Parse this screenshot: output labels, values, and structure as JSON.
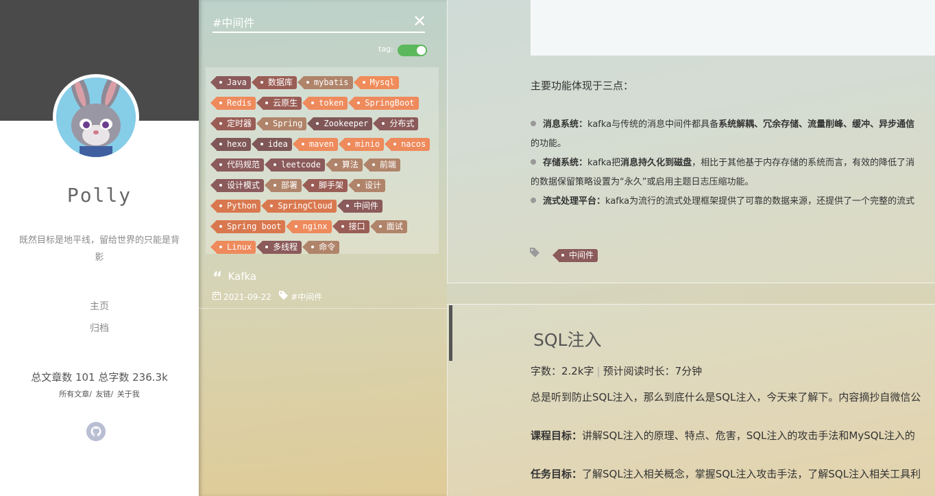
{
  "sidebar": {
    "author_name": "Polly",
    "motto": "既然目标是地平线，留给世界的只能是背影",
    "nav": [
      "主页",
      "归档"
    ],
    "stats": "总文章数 101 总字数 236.3k",
    "sub_links": [
      "所有文章/",
      "友链/",
      "关于我"
    ],
    "icons": {
      "github": "github-icon"
    }
  },
  "search": {
    "value": "#中间件",
    "toggle_label": "tag:",
    "toggle_on": true,
    "tags": [
      {
        "label": "Java",
        "color": "#8b5a5a",
        "mono": true
      },
      {
        "label": "数据库",
        "color": "#9a5d55",
        "mono": false
      },
      {
        "label": "mybatis",
        "color": "#b0846a",
        "mono": true
      },
      {
        "label": "Mysql",
        "color": "#f08c5a",
        "mono": true
      },
      {
        "label": "Redis",
        "color": "#ee8a5c",
        "mono": true
      },
      {
        "label": "云原生",
        "color": "#9a5d55",
        "mono": false
      },
      {
        "label": "token",
        "color": "#ee8a5c",
        "mono": true
      },
      {
        "label": "SpringBoot",
        "color": "#ee8a5c",
        "mono": true
      },
      {
        "label": "定时器",
        "color": "#9a5d55",
        "mono": false
      },
      {
        "label": "Spring",
        "color": "#b0846a",
        "mono": true
      },
      {
        "label": "Zookeeper",
        "color": "#7f5757",
        "mono": true
      },
      {
        "label": "分布式",
        "color": "#8b5a5a",
        "mono": false
      },
      {
        "label": "hexo",
        "color": "#7f5757",
        "mono": true
      },
      {
        "label": "idea",
        "color": "#7f5757",
        "mono": true
      },
      {
        "label": "maven",
        "color": "#ee8a5c",
        "mono": true
      },
      {
        "label": "minio",
        "color": "#ee8a5c",
        "mono": true
      },
      {
        "label": "nacos",
        "color": "#ee8a5c",
        "mono": true
      },
      {
        "label": "代码规范",
        "color": "#8b5a5a",
        "mono": false
      },
      {
        "label": "leetcode",
        "color": "#8b5a5a",
        "mono": true
      },
      {
        "label": "算法",
        "color": "#b0846a",
        "mono": false
      },
      {
        "label": "前端",
        "color": "#b0846a",
        "mono": false
      },
      {
        "label": "设计模式",
        "color": "#8b5a5a",
        "mono": false
      },
      {
        "label": "部署",
        "color": "#b0846a",
        "mono": false
      },
      {
        "label": "脚手架",
        "color": "#9a5d55",
        "mono": false
      },
      {
        "label": "设计",
        "color": "#b0846a",
        "mono": false
      },
      {
        "label": "Python",
        "color": "#d9784f",
        "mono": true
      },
      {
        "label": "SpringCloud",
        "color": "#d9784f",
        "mono": true
      },
      {
        "label": "中间件",
        "color": "#8b5a5a",
        "mono": false
      },
      {
        "label": "Spring boot",
        "color": "#d9784f",
        "mono": true
      },
      {
        "label": "nginx",
        "color": "#ee8a5c",
        "mono": true
      },
      {
        "label": "接口",
        "color": "#9a5d55",
        "mono": false
      },
      {
        "label": "面试",
        "color": "#b0846a",
        "mono": false
      },
      {
        "label": "Linux",
        "color": "#ee8a5c",
        "mono": true
      },
      {
        "label": "多线程",
        "color": "#8b5a5a",
        "mono": false
      },
      {
        "label": "命令",
        "color": "#b0846a",
        "mono": false
      }
    ],
    "result": {
      "title": "Kafka",
      "date": "2021-09-22",
      "tag": "#中间件"
    }
  },
  "article": {
    "intro": "主要功能体现于三点：",
    "bullets": [
      {
        "label": "消息系统：",
        "text_a": "kafka与传统的消息中间件都具备",
        "bold": "系统解耦、冗余存储、流量削峰、缓冲、异步通信",
        "text_b": "",
        "continuation": "的功能。"
      },
      {
        "label": "存储系统：",
        "text_a": "kafka把",
        "bold": "消息持久化到磁盘",
        "text_b": "，相比于其他基于内存存储的系统而言，有效的降低了消",
        "continuation": "的数据保留策略设置为“永久”或启用主题日志压缩功能。"
      },
      {
        "label": "流式处理平台：",
        "text_a": "kafka为流行的流式处理框架提供了可靠的数据来源，还提供了一个完整的流式",
        "bold": "",
        "text_b": "",
        "continuation": ""
      }
    ],
    "tag": "中间件"
  },
  "next_post": {
    "title": "SQL注入",
    "word_count": "字数：2.2k字",
    "read_time": "预计阅读时长：7分钟",
    "separator": "|",
    "excerpt": "总是听到防止SQL注入，那么到底什么是SQL注入，今天来了解下。内容摘抄自微信公",
    "goal_label": "课程目标：",
    "goal_text": "讲解SQL注入的原理、特点、危害，SQL注入的攻击手法和MySQL注入的",
    "task_label": "任务目标：",
    "task_text": "了解SQL注入相关概念，掌握SQL注入攻击手法，了解SQL注入相关工具利"
  }
}
